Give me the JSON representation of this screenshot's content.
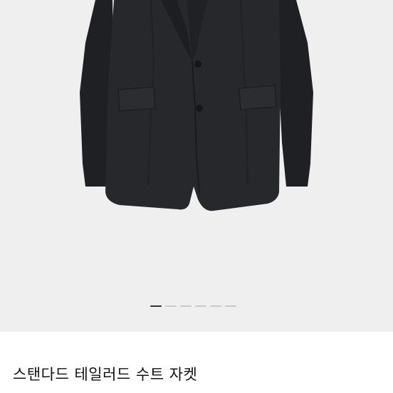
{
  "product": {
    "title": "스탠다드 테일러드 수트 자켓"
  },
  "image": {
    "subject": "black-blazer-icon",
    "background_color": "#efefef",
    "garment_color": "#27282b"
  },
  "carousel": {
    "total": 6,
    "active_index": 0
  }
}
